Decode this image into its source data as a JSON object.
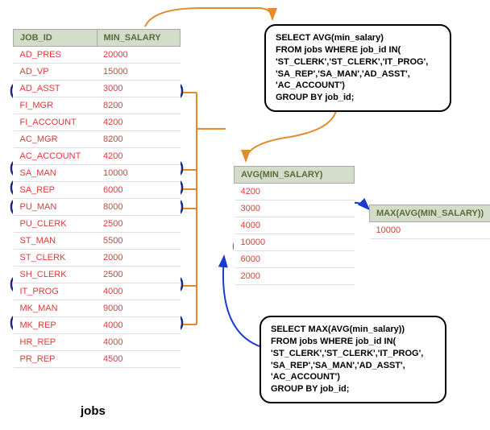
{
  "jobs_table": {
    "headers": [
      "JOB_ID",
      "MIN_SALARY"
    ],
    "rows": [
      [
        "AD_PRES",
        "20000"
      ],
      [
        "AD_VP",
        "15000"
      ],
      [
        "AD_ASST",
        "3000"
      ],
      [
        "FI_MGR",
        "8200"
      ],
      [
        "FI_ACCOUNT",
        "4200"
      ],
      [
        "AC_MGR",
        "8200"
      ],
      [
        "AC_ACCOUNT",
        "4200"
      ],
      [
        "SA_MAN",
        "10000"
      ],
      [
        "SA_REP",
        "6000"
      ],
      [
        "PU_MAN",
        "8000"
      ],
      [
        "PU_CLERK",
        "2500"
      ],
      [
        "ST_MAN",
        "5500"
      ],
      [
        "ST_CLERK",
        "2000"
      ],
      [
        "SH_CLERK",
        "2500"
      ],
      [
        "IT_PROG",
        "4000"
      ],
      [
        "MK_MAN",
        "9000"
      ],
      [
        "MK_REP",
        "4000"
      ],
      [
        "HR_REP",
        "4000"
      ],
      [
        "PR_REP",
        "4500"
      ]
    ],
    "label": "jobs"
  },
  "avg_table": {
    "header": "AVG(MIN_SALARY)",
    "rows": [
      "4200",
      "3000",
      "4000",
      "10000",
      "6000",
      "2000"
    ]
  },
  "max_table": {
    "header": "MAX(AVG(MIN_SALARY))",
    "rows": [
      "10000"
    ]
  },
  "sql1": {
    "l1": "SELECT AVG(min_salary)",
    "l2": "FROM jobs WHERE job_id IN(",
    "l3": " 'ST_CLERK','ST_CLERK','IT_PROG',",
    "l4": " 'SA_REP','SA_MAN','AD_ASST',",
    "l5": " 'AC_ACCOUNT')",
    "l6": "GROUP BY job_id;"
  },
  "sql2": {
    "l1": "SELECT MAX(AVG(min_salary))",
    "l2": "FROM jobs WHERE job_id IN(",
    "l3": " 'ST_CLERK','ST_CLERK','IT_PROG',",
    "l4": " 'SA_REP','SA_MAN','AD_ASST',",
    "l5": " 'AC_ACCOUNT')",
    "l6": "GROUP BY job_id;"
  },
  "highlighted_jobs_rows": [
    2,
    6,
    7,
    8,
    12,
    14
  ],
  "highlighted_avg_row": 3
}
